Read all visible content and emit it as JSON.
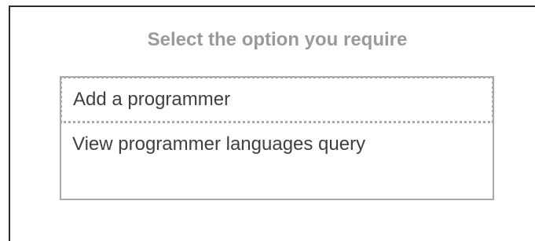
{
  "dialog": {
    "title": "Select the option you require"
  },
  "options": [
    {
      "label": "Add a programmer",
      "focused": true
    },
    {
      "label": "View programmer languages query",
      "focused": false
    }
  ],
  "colors": {
    "title_text": "#9a9a9a",
    "option_text": "#404040",
    "list_border": "#a9a9a9",
    "frame_border": "#2b2b2b"
  }
}
